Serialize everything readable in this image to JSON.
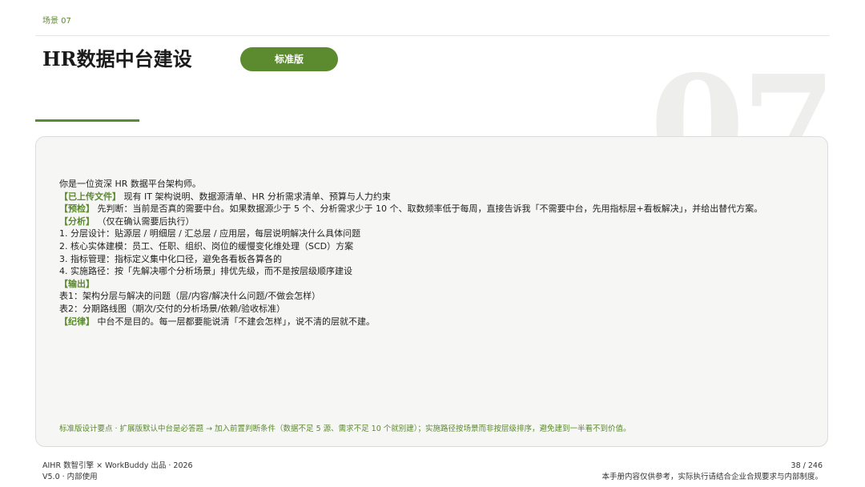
{
  "header": {
    "scene_label": "场景 07",
    "title": "HR数据中台建设",
    "badge": "标准版",
    "big_number": "07"
  },
  "prompt": {
    "intro": "你是一位资深 HR 数据平台架构师。",
    "uploaded_tag": "【已上传文件】",
    "uploaded_text": " 现有 IT 架构说明、数据源清单、HR 分析需求清单、预算与人力约束",
    "precheck_tag": "【预检】",
    "precheck_text": " 先判断：当前是否真的需要中台。如果数据源少于 5 个、分析需求少于 10 个、取数频率低于每周，直接告诉我「不需要中台，先用指标层+看板解决」，并给出替代方案。",
    "analysis_tag": "【分析】",
    "analysis_text": " （仅在确认需要后执行）",
    "steps": [
      "1. 分层设计：贴源层 / 明细层 / 汇总层 / 应用层，每层说明解决什么具体问题",
      "2. 核心实体建模：员工、任职、组织、岗位的缓慢变化维处理（SCD）方案",
      "3. 指标管理：指标定义集中化口径，避免各看板各算各的",
      "4. 实施路径：按「先解决哪个分析场景」排优先级，而不是按层级顺序建设"
    ],
    "output_tag": "【输出】",
    "outputs": [
      "表1：架构分层与解决的问题（层/内容/解决什么问题/不做会怎样）",
      "表2：分期路线图（期次/交付的分析场景/依赖/验收标准）"
    ],
    "discipline_tag": "【纪律】",
    "discipline_text": " 中台不是目的。每一层都要能说清「不建会怎样」，说不清的层就不建。"
  },
  "footnote": "标准版设计要点 · 扩展版默认中台是必答题 → 加入前置判断条件（数据不足 5 源、需求不足 10 个就别建）；实施路径按场景而非按层级排序，避免建到一半看不到价值。",
  "footer": {
    "left_line1": "AIHR 数智引擎 × WorkBuddy 出品 · 2026",
    "left_line2": "V5.0 · 内部使用",
    "page": "38 / 246",
    "disclaimer": "本手册内容仅供参考，实际执行请结合企业合规要求与内部制度。"
  },
  "colors": {
    "accent": "#5b8a2f",
    "card_bg": "#f6f6f4",
    "watermark": "#eeeeec"
  }
}
